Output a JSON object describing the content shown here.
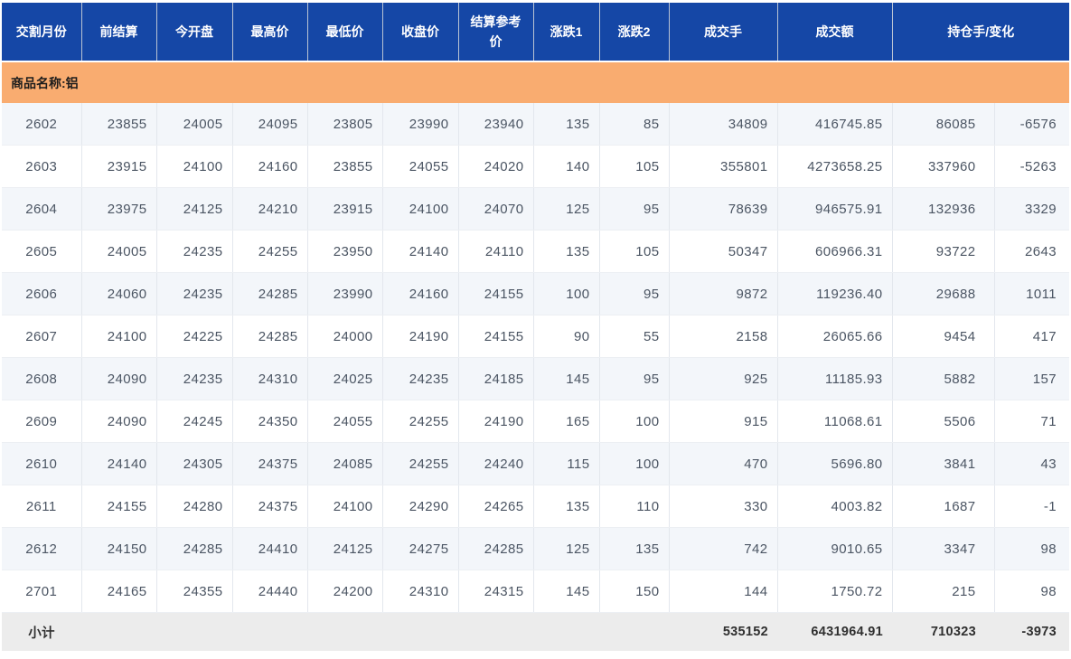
{
  "table": {
    "columns": [
      {
        "id": "delivery-month",
        "label": "交割月份",
        "span": 1
      },
      {
        "id": "prev-settlement",
        "label": "前结算",
        "span": 1
      },
      {
        "id": "open",
        "label": "今开盘",
        "span": 1
      },
      {
        "id": "high",
        "label": "最高价",
        "span": 1
      },
      {
        "id": "low",
        "label": "最低价",
        "span": 1
      },
      {
        "id": "close",
        "label": "收盘价",
        "span": 1
      },
      {
        "id": "settlement-ref",
        "label": "结算参考价",
        "span": 1
      },
      {
        "id": "change1",
        "label": "涨跌1",
        "span": 1
      },
      {
        "id": "change2",
        "label": "涨跌2",
        "span": 1
      },
      {
        "id": "volume",
        "label": "成交手",
        "span": 1
      },
      {
        "id": "turnover",
        "label": "成交额",
        "span": 1
      },
      {
        "id": "open-interest-change",
        "label": "持仓手/变化",
        "span": 2
      }
    ],
    "cell_ids": [
      "delivery-month",
      "prev-settlement",
      "open",
      "high",
      "low",
      "close",
      "settlement-ref",
      "change1",
      "change2",
      "volume",
      "turnover",
      "open-interest",
      "oi-change"
    ],
    "group_label": "商品名称:铝",
    "rows": [
      [
        "2602",
        "23855",
        "24005",
        "24095",
        "23805",
        "23990",
        "23940",
        "135",
        "85",
        "34809",
        "416745.85",
        "86085",
        "-6576"
      ],
      [
        "2603",
        "23915",
        "24100",
        "24160",
        "23855",
        "24055",
        "24020",
        "140",
        "105",
        "355801",
        "4273658.25",
        "337960",
        "-5263"
      ],
      [
        "2604",
        "23975",
        "24125",
        "24210",
        "23915",
        "24100",
        "24070",
        "125",
        "95",
        "78639",
        "946575.91",
        "132936",
        "3329"
      ],
      [
        "2605",
        "24005",
        "24235",
        "24255",
        "23950",
        "24140",
        "24110",
        "135",
        "105",
        "50347",
        "606966.31",
        "93722",
        "2643"
      ],
      [
        "2606",
        "24060",
        "24235",
        "24285",
        "23990",
        "24160",
        "24155",
        "100",
        "95",
        "9872",
        "119236.40",
        "29688",
        "1011"
      ],
      [
        "2607",
        "24100",
        "24225",
        "24285",
        "24000",
        "24190",
        "24155",
        "90",
        "55",
        "2158",
        "26065.66",
        "9454",
        "417"
      ],
      [
        "2608",
        "24090",
        "24235",
        "24310",
        "24025",
        "24235",
        "24185",
        "145",
        "95",
        "925",
        "11185.93",
        "5882",
        "157"
      ],
      [
        "2609",
        "24090",
        "24245",
        "24350",
        "24055",
        "24255",
        "24190",
        "165",
        "100",
        "915",
        "11068.61",
        "5506",
        "71"
      ],
      [
        "2610",
        "24140",
        "24305",
        "24375",
        "24085",
        "24255",
        "24240",
        "115",
        "100",
        "470",
        "5696.80",
        "3841",
        "43"
      ],
      [
        "2611",
        "24155",
        "24280",
        "24375",
        "24100",
        "24290",
        "24265",
        "135",
        "110",
        "330",
        "4003.82",
        "1687",
        "-1"
      ],
      [
        "2612",
        "24150",
        "24285",
        "24410",
        "24125",
        "24275",
        "24285",
        "125",
        "135",
        "742",
        "9010.65",
        "3347",
        "98"
      ],
      [
        "2701",
        "24165",
        "24355",
        "24440",
        "24200",
        "24310",
        "24315",
        "145",
        "150",
        "144",
        "1750.72",
        "215",
        "98"
      ]
    ],
    "subtotal": [
      "小计",
      "",
      "",
      "",
      "",
      "",
      "",
      "",
      "",
      "535152",
      "6431964.91",
      "710323",
      "-3973"
    ]
  },
  "colors": {
    "header_bg": "#1547A6",
    "group_bg": "#F9AC70",
    "stripe_bg": "#F3F6FA",
    "subtotal_bg": "#ECECEC",
    "header_text": "#FFFFFF"
  }
}
